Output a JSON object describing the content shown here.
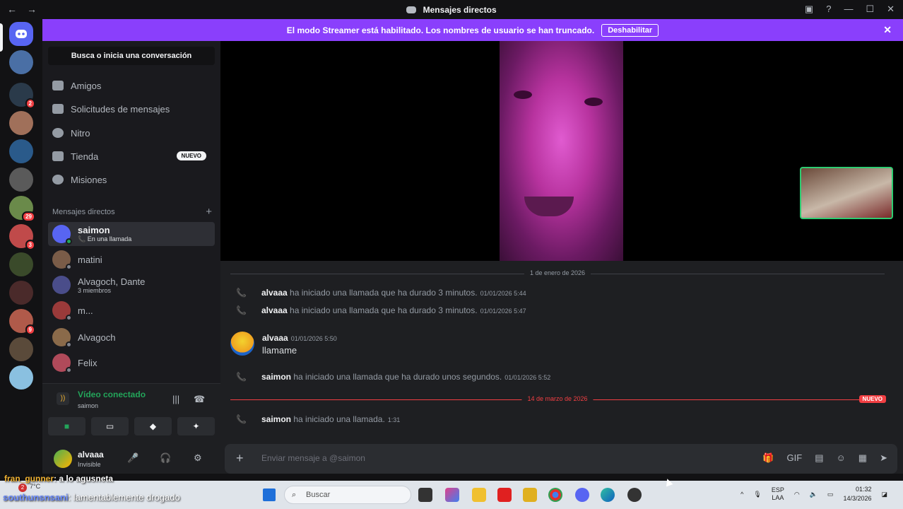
{
  "window": {
    "title": "Mensajes directos",
    "nav": {
      "back": "←",
      "forward": "→"
    },
    "controls": {
      "inbox": "▣",
      "help": "?",
      "minimize": "—",
      "maximize": "☐",
      "close": "✕"
    }
  },
  "banner": {
    "text": "El modo Streamer está habilitado. Los nombres de usuario se han truncado.",
    "button": "Deshabilitar",
    "close": "✕"
  },
  "rail": {
    "servers": [
      {
        "badge": ""
      },
      {
        "badge": "2"
      },
      {
        "badge": ""
      },
      {
        "badge": ""
      },
      {
        "badge": ""
      },
      {
        "badge": "29"
      },
      {
        "badge": "3"
      },
      {
        "badge": ""
      },
      {
        "badge": ""
      },
      {
        "badge": "9"
      },
      {
        "badge": ""
      },
      {
        "badge": ""
      }
    ]
  },
  "sidebar": {
    "search_label": "Busca o inicia una conversación",
    "menu": [
      {
        "label": "Amigos",
        "icon": "friends-icon"
      },
      {
        "label": "Solicitudes de mensajes",
        "icon": "mail-icon"
      },
      {
        "label": "Nitro",
        "icon": "nitro-icon"
      },
      {
        "label": "Tienda",
        "icon": "shop-icon",
        "badge": "NUEVO"
      },
      {
        "label": "Misiones",
        "icon": "quests-icon"
      }
    ],
    "dm_header": "Mensajes directos",
    "dm_add": "+",
    "dms": [
      {
        "name": "saimon",
        "sub": "📞 En una llamada",
        "color": "#5865f2"
      },
      {
        "name": "matini",
        "sub": "",
        "color": "#7a5c48"
      },
      {
        "name": "Alvagoch, Dante",
        "sub": "3 miembros",
        "color": "#4a4d8a"
      },
      {
        "name": "m...",
        "sub": "",
        "color": "#9a3a3a"
      },
      {
        "name": "Alvagoch",
        "sub": "",
        "color": "#8a6a4a"
      },
      {
        "name": "Felix",
        "sub": "",
        "color": "#b04a5a"
      }
    ]
  },
  "voice": {
    "status": "Vídeo conectado",
    "user": "saimon",
    "signal_icon": "))",
    "noise_icon": "|||",
    "hangup_icon": "☎",
    "buttons": [
      "■",
      "▭",
      "◆",
      "✦"
    ]
  },
  "user_panel": {
    "name": "alvaaa",
    "status": "Invisible",
    "mic": "🎤",
    "headset": "🎧",
    "settings": "⚙"
  },
  "chat": {
    "divider1": "1 de enero de 2026",
    "calls": [
      {
        "user": "alvaaa",
        "text": "ha iniciado una llamada que ha durado 3 minutos.",
        "time": "01/01/2026 5:44"
      },
      {
        "user": "alvaaa",
        "text": "ha iniciado una llamada que ha durado 3 minutos.",
        "time": "01/01/2026 5:47"
      }
    ],
    "message": {
      "user": "alvaaa",
      "time": "01/01/2026 5:50",
      "text": "llamame"
    },
    "call3": {
      "user": "saimon",
      "text": "ha iniciado una llamada que ha durado unos segundos.",
      "time": "01/01/2026 5:52"
    },
    "divider2": "14 de marzo de 2026",
    "new_tag": "NUEVO",
    "call4": {
      "user": "saimon",
      "text": "ha iniciado una llamada.",
      "time": "1:31"
    },
    "phone_icon": "📞"
  },
  "composer": {
    "placeholder": "Enviar mensaje a @saimon",
    "plus": "+",
    "tools": [
      "🎁",
      "GIF",
      "▤",
      "☺",
      "▦",
      "➤"
    ]
  },
  "overlay": {
    "line1_user": "fran_gunner",
    "line1_text": ": a lo agusneta",
    "line2_user": "southunsnsani",
    "line2_text": ": lamentablemente drogado"
  },
  "taskbar": {
    "weather_badge": "2",
    "temp": "7°C",
    "search": "Buscar",
    "lang1": "ESP",
    "lang2": "LAA",
    "time": "01:32",
    "date": "14/3/2026"
  }
}
